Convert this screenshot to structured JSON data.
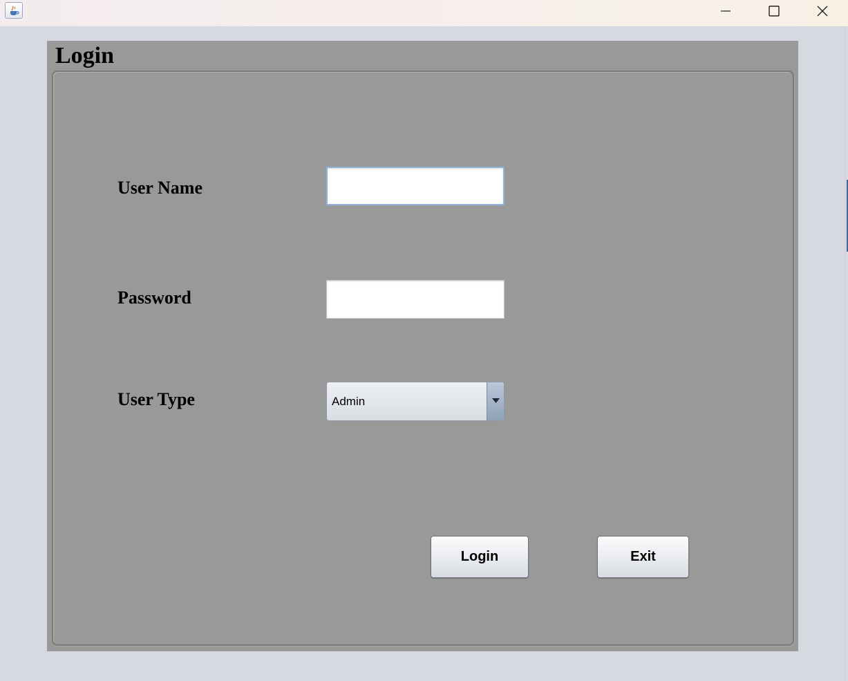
{
  "window": {
    "controls": {
      "minimize_icon": "minimize-icon",
      "maximize_icon": "maximize-icon",
      "close_icon": "close-icon"
    },
    "app_icon": "java-cup-icon"
  },
  "form": {
    "heading": "Login",
    "fields": {
      "username_label": "User Name",
      "username_value": "",
      "password_label": "Password",
      "password_value": "",
      "usertype_label": "User Type",
      "usertype_selected": "Admin"
    },
    "buttons": {
      "login_label": "Login",
      "exit_label": "Exit"
    }
  },
  "colors": {
    "panel_background": "#999999",
    "window_background": "#d6d9df",
    "focus_border": "#8fb4d9"
  }
}
